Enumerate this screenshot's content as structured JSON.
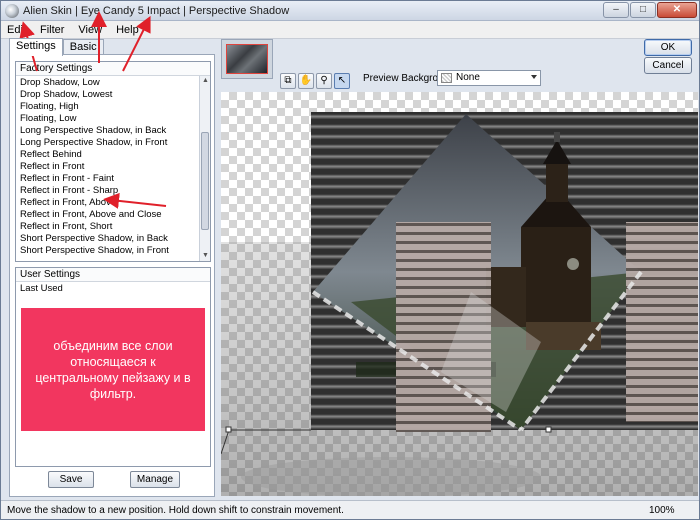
{
  "window": {
    "title": "Alien Skin | Eye Candy 5 Impact | Perspective Shadow",
    "minimize_glyph": "–",
    "maximize_glyph": "□",
    "close_glyph": "✕"
  },
  "menu": {
    "items": [
      "Edit",
      "Filter",
      "View",
      "Help"
    ]
  },
  "tabs": [
    {
      "label": "Settings",
      "active": true
    },
    {
      "label": "Basic",
      "active": false
    }
  ],
  "factory_settings": {
    "header": "Factory Settings",
    "items": [
      "Drop Shadow, Low",
      "Drop Shadow, Lowest",
      "Floating, High",
      "Floating, Low",
      "Long Perspective Shadow, in Back",
      "Long Perspective Shadow, in Front",
      "Reflect Behind",
      "Reflect in Front",
      "Reflect in Front - Faint",
      "Reflect in Front - Sharp",
      "Reflect in Front, Above",
      "Reflect in Front, Above and Close",
      "Reflect in Front, Short",
      "Short Perspective Shadow, in Back",
      "Short Perspective Shadow, in Front"
    ]
  },
  "user_settings": {
    "header": "User Settings",
    "items": [
      "Last Used"
    ]
  },
  "buttons": {
    "save": "Save",
    "manage": "Manage",
    "ok": "OK",
    "cancel": "Cancel"
  },
  "preview": {
    "label": "Preview Background:",
    "value": "None"
  },
  "toolbar": {
    "tools": [
      "preview-toggle-icon",
      "hand-icon",
      "zoom-icon",
      "pointer-icon"
    ]
  },
  "annotation": {
    "text": "объединим все слои относящаеся к центральному пейзажу и в фильтр.",
    "color": "#f2365f"
  },
  "status": {
    "text": "Move the shadow to a new position. Hold down shift to constrain movement.",
    "zoom": "100%"
  },
  "colors": {
    "arrow": "#e0202a",
    "canvas_checker": "#d4d4d4"
  }
}
